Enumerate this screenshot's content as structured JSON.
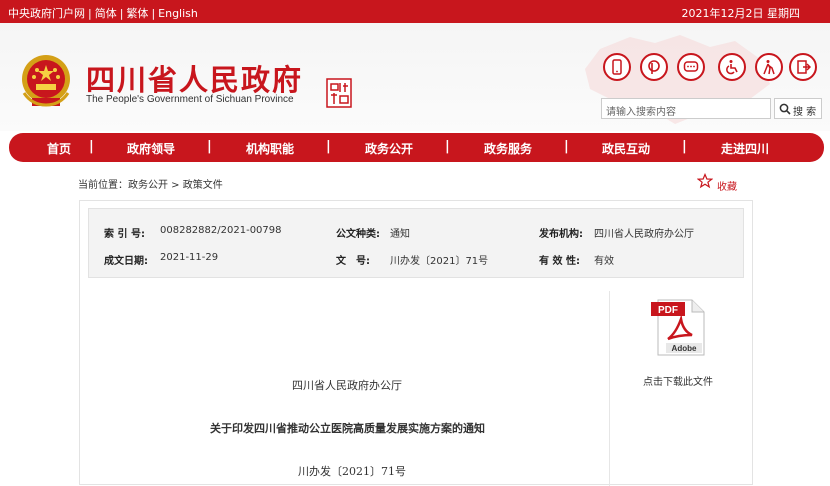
{
  "topbar": {
    "links": [
      "中央政府门户网",
      "简体",
      "繁体",
      "English"
    ],
    "separator": "|",
    "date": "2021年12月2日 星期四"
  },
  "header": {
    "title": "四川省人民政府",
    "subtitle": "The People's Government of Sichuan Province",
    "accent_color": "#c8161d",
    "icons": [
      "mobile-icon",
      "weibo-icon",
      "message-icon",
      "accessibility-icon",
      "elderly-icon",
      "exit-icon"
    ],
    "search": {
      "placeholder": "请输入搜索内容",
      "button_label": "搜 索"
    }
  },
  "nav": {
    "items": [
      "首页",
      "政府领导",
      "机构职能",
      "政务公开",
      "政务服务",
      "政民互动",
      "走进四川"
    ],
    "separator": "|"
  },
  "breadcrumb": {
    "label": "当前位置：",
    "path": "政务公开 > 政策文件"
  },
  "favorite_label": "收藏",
  "meta": {
    "index_label": "索 引 号:",
    "index_value": "008282882/2021-00798",
    "category_label": "公文种类:",
    "category_value": "通知",
    "issuer_label": "发布机构:",
    "issuer_value": "四川省人民政府办公厅",
    "date_label": "成文日期:",
    "date_value": "2021-11-29",
    "docno_label": "文　号:",
    "docno_value": "川办发〔2021〕71号",
    "validity_label": "有 效 性:",
    "validity_value": "有效"
  },
  "download": {
    "label": "点击下载此文件",
    "icon_text_pdf": "PDF",
    "icon_text_brand": "Adobe"
  },
  "document": {
    "issuer": "四川省人民政府办公厅",
    "title": "关于印发四川省推动公立医院高质量发展实施方案的通知",
    "number": "川办发〔2021〕71号"
  }
}
